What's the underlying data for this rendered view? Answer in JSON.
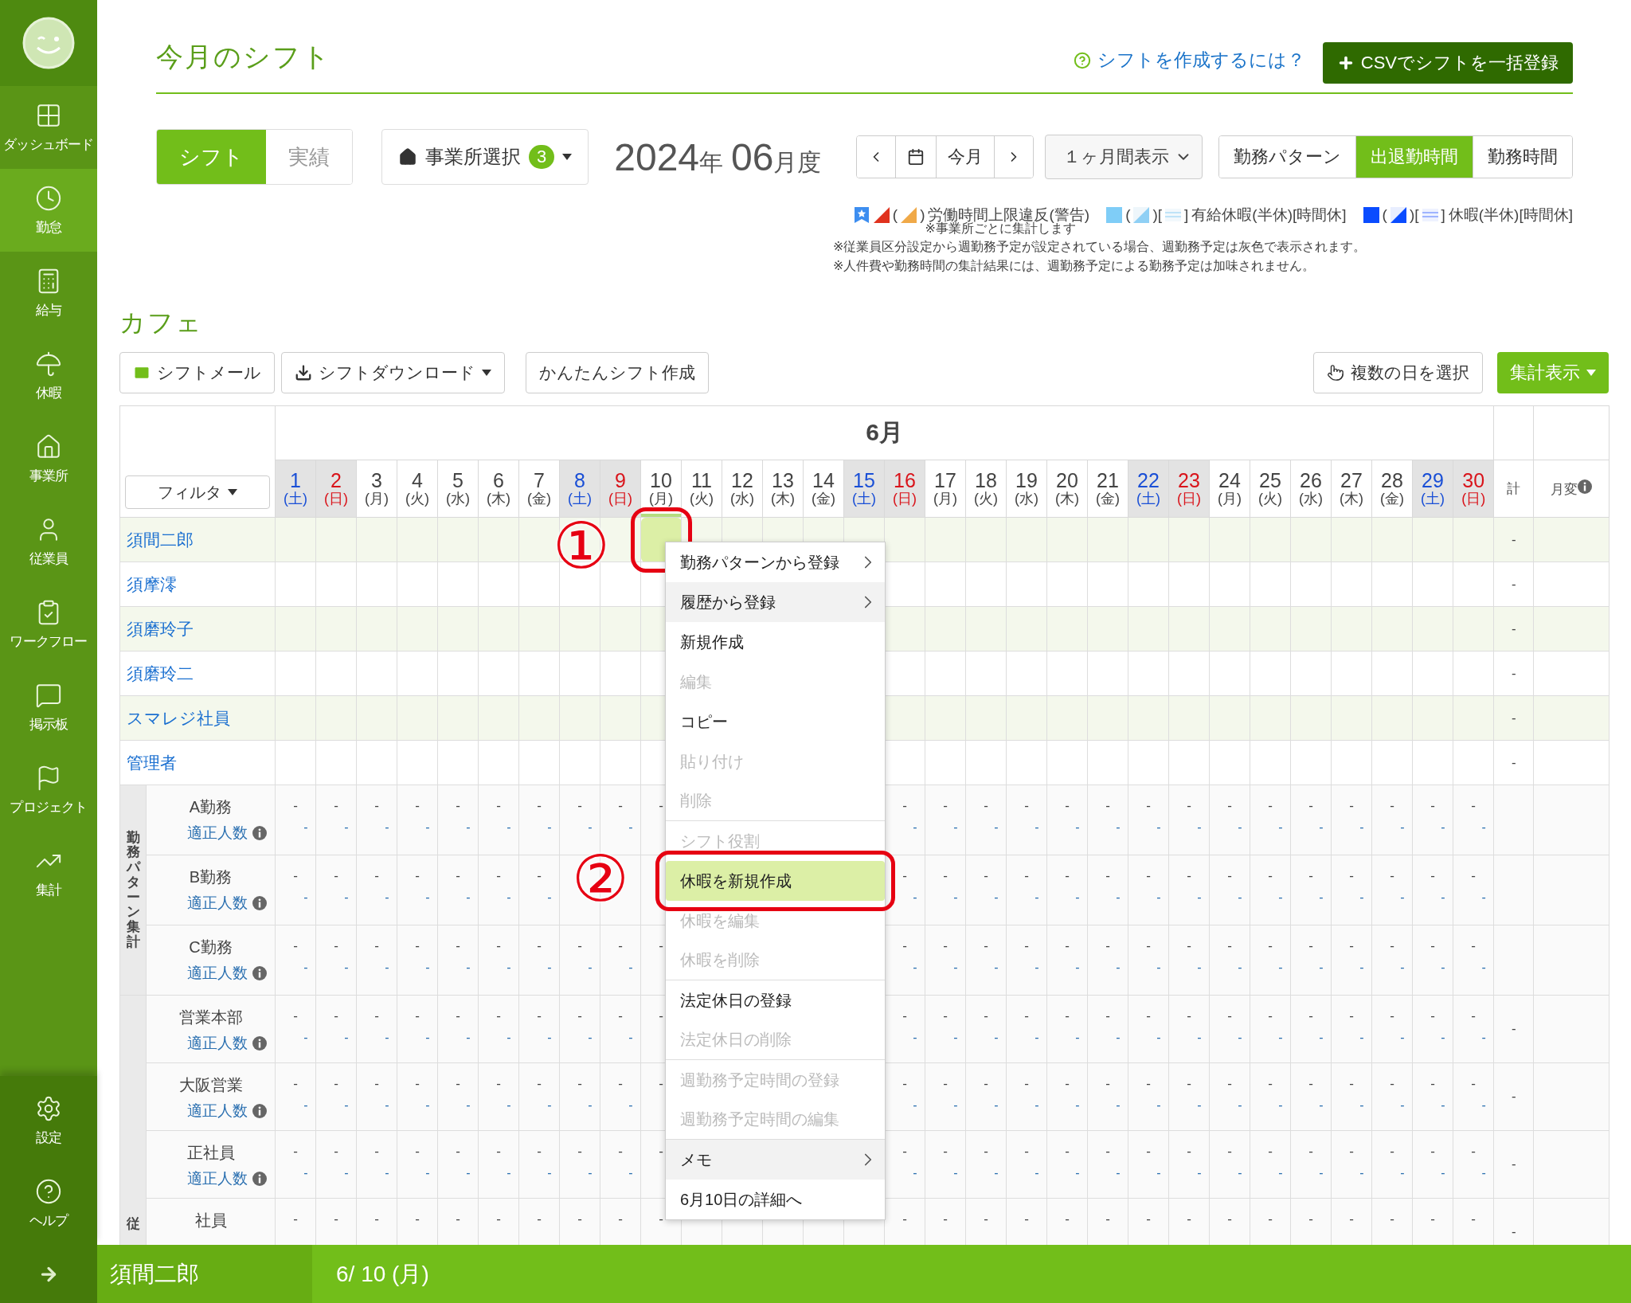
{
  "sidebar": {
    "items": [
      {
        "label": "ダッシュボード",
        "selected": false
      },
      {
        "label": "勤怠",
        "selected": true
      },
      {
        "label": "給与",
        "selected": false
      },
      {
        "label": "休暇",
        "selected": false
      },
      {
        "label": "事業所",
        "selected": false
      },
      {
        "label": "従業員",
        "selected": false
      },
      {
        "label": "ワークフロー",
        "selected": false
      },
      {
        "label": "掲示板",
        "selected": false
      },
      {
        "label": "プロジェクト",
        "selected": false
      },
      {
        "label": "集計",
        "selected": false
      }
    ],
    "bottom_items": [
      {
        "label": "設定"
      },
      {
        "label": "ヘルプ"
      }
    ]
  },
  "header": {
    "title": "今月のシフト",
    "help_link": "シフトを作成するには？",
    "csv_button": "CSVでシフトを一括登録"
  },
  "toolbar": {
    "mode_tabs": [
      {
        "label": "シフト",
        "selected": true
      },
      {
        "label": "実績",
        "selected": false
      }
    ],
    "office_button": {
      "label": "事業所選択",
      "count": "3"
    },
    "period": {
      "year": "2024",
      "year_unit": "年",
      "month": "06",
      "month_unit": "月度"
    },
    "nav": {
      "today": "今月"
    },
    "range_select": "１ヶ月間表示",
    "view_tabs": [
      {
        "label": "勤務パターン",
        "selected": false
      },
      {
        "label": "出退勤時間",
        "selected": true
      },
      {
        "label": "勤務時間",
        "selected": false
      }
    ]
  },
  "legend": [
    {
      "parts": [
        {
          "kind": "star"
        },
        {
          "kind": "red-triangle"
        },
        {
          "text": "("
        },
        {
          "kind": "orange-triangle"
        },
        {
          "text": ")"
        }
      ],
      "label": "労働時間上限違反(警告)",
      "note": "※事業所ごとに集計します"
    },
    {
      "parts": [
        {
          "kind": "light-square"
        },
        {
          "text": "("
        },
        {
          "kind": "light-triangle"
        },
        {
          "text": ")["
        },
        {
          "kind": "light-stripes"
        },
        {
          "text": "]"
        }
      ],
      "label": "有給休暇(半休)[時間休]"
    },
    {
      "parts": [
        {
          "kind": "blue-square"
        },
        {
          "text": "("
        },
        {
          "kind": "blue-triangle"
        },
        {
          "text": ")["
        },
        {
          "kind": "blue-stripes"
        },
        {
          "text": "]"
        }
      ],
      "label": "休暇(半休)[時間休]"
    }
  ],
  "notes": [
    "※従業員区分設定から週勤務予定が設定されている場合、週勤務予定は灰色で表示されます。",
    "※人件費や勤務時間の集計結果には、週勤務予定による勤務予定は加味されません。"
  ],
  "section": {
    "title": "カフェ",
    "left_buttons": [
      "シフトメール",
      "シフトダウンロード",
      "かんたんシフト作成"
    ],
    "multi_select_button": "複数の日を選択",
    "summary_button": "集計表示"
  },
  "table": {
    "filter": "フィルタ",
    "month": "6月",
    "total_header": "計",
    "change_header": "月変",
    "days": [
      {
        "day": "1",
        "weekday": "(土)",
        "kind": "sat",
        "selected": false
      },
      {
        "day": "2",
        "weekday": "(日)",
        "kind": "sun",
        "selected": false
      },
      {
        "day": "3",
        "weekday": "(月)",
        "kind": "weekday",
        "selected": false
      },
      {
        "day": "4",
        "weekday": "(火)",
        "kind": "weekday",
        "selected": false
      },
      {
        "day": "5",
        "weekday": "(水)",
        "kind": "weekday",
        "selected": false
      },
      {
        "day": "6",
        "weekday": "(木)",
        "kind": "weekday",
        "selected": false
      },
      {
        "day": "7",
        "weekday": "(金)",
        "kind": "weekday",
        "selected": false
      },
      {
        "day": "8",
        "weekday": "(土)",
        "kind": "sat",
        "selected": false
      },
      {
        "day": "9",
        "weekday": "(日)",
        "kind": "sun",
        "selected": false
      },
      {
        "day": "10",
        "weekday": "(月)",
        "kind": "weekday",
        "selected": true
      },
      {
        "day": "11",
        "weekday": "(火)",
        "kind": "weekday",
        "selected": false
      },
      {
        "day": "12",
        "weekday": "(水)",
        "kind": "weekday",
        "selected": false
      },
      {
        "day": "13",
        "weekday": "(木)",
        "kind": "weekday",
        "selected": false
      },
      {
        "day": "14",
        "weekday": "(金)",
        "kind": "weekday",
        "selected": false
      },
      {
        "day": "15",
        "weekday": "(土)",
        "kind": "sat",
        "selected": false
      },
      {
        "day": "16",
        "weekday": "(日)",
        "kind": "sun",
        "selected": false
      },
      {
        "day": "17",
        "weekday": "(月)",
        "kind": "weekday",
        "selected": false
      },
      {
        "day": "18",
        "weekday": "(火)",
        "kind": "weekday",
        "selected": false
      },
      {
        "day": "19",
        "weekday": "(水)",
        "kind": "weekday",
        "selected": false
      },
      {
        "day": "20",
        "weekday": "(木)",
        "kind": "weekday",
        "selected": false
      },
      {
        "day": "21",
        "weekday": "(金)",
        "kind": "weekday",
        "selected": false
      },
      {
        "day": "22",
        "weekday": "(土)",
        "kind": "sat",
        "selected": false
      },
      {
        "day": "23",
        "weekday": "(日)",
        "kind": "sun",
        "selected": false
      },
      {
        "day": "24",
        "weekday": "(月)",
        "kind": "weekday",
        "selected": false
      },
      {
        "day": "25",
        "weekday": "(火)",
        "kind": "weekday",
        "selected": false
      },
      {
        "day": "26",
        "weekday": "(水)",
        "kind": "weekday",
        "selected": false
      },
      {
        "day": "27",
        "weekday": "(木)",
        "kind": "weekday",
        "selected": false
      },
      {
        "day": "28",
        "weekday": "(金)",
        "kind": "weekday",
        "selected": false
      },
      {
        "day": "29",
        "weekday": "(土)",
        "kind": "sat",
        "selected": false
      },
      {
        "day": "30",
        "weekday": "(日)",
        "kind": "sun",
        "selected": false
      }
    ],
    "employees": [
      {
        "name": "須間二郎",
        "selected": true,
        "total": "-"
      },
      {
        "name": "須摩澪",
        "selected": false,
        "total": "-"
      },
      {
        "name": "須磨玲子",
        "selected": false,
        "total": "-"
      },
      {
        "name": "須磨玲二",
        "selected": false,
        "total": "-"
      },
      {
        "name": "スマレジ社員",
        "selected": false,
        "total": "-"
      },
      {
        "name": "管理者",
        "selected": false,
        "total": "-"
      }
    ],
    "summary_groups": [
      {
        "label": "勤務パターン集計",
        "rows": [
          {
            "name": "A勤務",
            "sub": "適正人数",
            "values": [
              "-",
              "-",
              "-",
              "-",
              "-",
              "-",
              "-",
              "-",
              "-",
              "-",
              "-",
              "-",
              "-",
              "-",
              "-",
              "-",
              "-",
              "-",
              "-",
              "-",
              "-",
              "-",
              "-",
              "-",
              "-"
            ],
            "counts": [
              "-",
              "-",
              "-",
              "-",
              "-",
              "-",
              "-",
              "-",
              "-",
              "-",
              "-",
              "-",
              "-",
              "-",
              "-",
              "-",
              "-",
              "-",
              "-",
              "-",
              "-",
              "-",
              "-",
              "-"
            ]
          },
          {
            "name": "B勤務",
            "sub": "適正人数",
            "values": [
              "-",
              "-",
              "-",
              "-",
              "-",
              "-",
              "-",
              "-",
              "-",
              "-",
              "-",
              "-",
              "-",
              "-",
              "-",
              "-",
              "-",
              "-",
              "-",
              "-",
              "-",
              "-"
            ],
            "counts": [
              "-",
              "-",
              "-",
              "-",
              "-",
              "-",
              "-",
              "-",
              "-",
              "-",
              "-",
              "-",
              "-",
              "-",
              "-",
              "-",
              "-",
              "-",
              "-",
              "-",
              "-",
              "-"
            ]
          },
          {
            "name": "C勤務",
            "sub": "適正人数",
            "values": [
              "-",
              "-",
              "-",
              "-",
              "-",
              "-",
              "-",
              "-",
              "-",
              "-",
              "-",
              "-",
              "-",
              "-",
              "-",
              "-",
              "-",
              "-",
              "-",
              "-",
              "-",
              "-",
              "-",
              "-",
              "-"
            ],
            "counts": [
              "-",
              "-",
              "-",
              "-",
              "-",
              "-",
              "-",
              "-",
              "-",
              "-",
              "-",
              "-",
              "-",
              "-",
              "-",
              "-",
              "-",
              "-",
              "-",
              "-",
              "-",
              "-",
              "-",
              "-"
            ]
          }
        ]
      },
      {
        "label": "従",
        "rows": [
          {
            "name": "営業本部",
            "sub": "適正人数",
            "total": "-",
            "values": [
              "-",
              "-",
              "-",
              "-",
              "-",
              "-",
              "-",
              "-",
              "-",
              "-",
              "-",
              "-",
              "-",
              "-",
              "-",
              "-",
              "-",
              "-",
              "-",
              "-",
              "-",
              "-",
              "-",
              "-",
              "-"
            ],
            "counts": [
              "-",
              "-",
              "-",
              "-",
              "-",
              "-",
              "-",
              "-",
              "-",
              "-",
              "-",
              "-",
              "-",
              "-",
              "-",
              "-",
              "-",
              "-",
              "-",
              "-",
              "-",
              "-",
              "-",
              "-"
            ]
          },
          {
            "name": "大阪営業",
            "sub": "適正人数",
            "total": "-",
            "values": [
              "-",
              "-",
              "-",
              "-",
              "-",
              "-",
              "-",
              "-",
              "-",
              "-",
              "-",
              "-",
              "-",
              "-",
              "-",
              "-",
              "-",
              "-",
              "-",
              "-",
              "-",
              "-",
              "-",
              "-",
              "-"
            ],
            "counts": [
              "-",
              "-",
              "-",
              "-",
              "-",
              "-",
              "-",
              "-",
              "-",
              "-",
              "-",
              "-",
              "-",
              "-",
              "-",
              "-",
              "-",
              "-",
              "-",
              "-",
              "-",
              "-",
              "-",
              "-"
            ]
          },
          {
            "name": "正社員",
            "sub": "適正人数",
            "total": "-",
            "values": [
              "-",
              "-",
              "-",
              "-",
              "-",
              "-",
              "-",
              "-",
              "-",
              "-",
              "-",
              "-",
              "-",
              "-",
              "-",
              "-",
              "-",
              "-",
              "-",
              "-",
              "-",
              "-",
              "-",
              "-",
              "-"
            ],
            "counts": [
              "-",
              "-",
              "-",
              "-",
              "-",
              "-",
              "-",
              "-",
              "-",
              "-",
              "-",
              "-",
              "-",
              "-",
              "-",
              "-",
              "-",
              "-",
              "-",
              "-",
              "-",
              "-",
              "-",
              "-"
            ]
          },
          {
            "name": "社員",
            "total": "-",
            "values": [
              "-",
              "-",
              "-",
              "-",
              "-",
              "-",
              "-",
              "-",
              "-",
              "-",
              "-",
              "-",
              "-",
              "-",
              "-",
              "-",
              "-",
              "-",
              "-",
              "-",
              "-",
              "-",
              "-",
              "-",
              "-"
            ]
          }
        ]
      }
    ]
  },
  "context_menu": {
    "items": [
      {
        "label": "勤務パターンから登録",
        "disabled": false,
        "has_submenu": true,
        "shaded": false,
        "selected": false,
        "separator_after": false
      },
      {
        "label": "履歴から登録",
        "disabled": false,
        "has_submenu": true,
        "shaded": true,
        "selected": false,
        "separator_after": false
      },
      {
        "label": "新規作成",
        "disabled": false,
        "has_submenu": false,
        "shaded": false,
        "selected": false,
        "separator_after": false
      },
      {
        "label": "編集",
        "disabled": true,
        "has_submenu": false,
        "shaded": false,
        "selected": false,
        "separator_after": false
      },
      {
        "label": "コピー",
        "disabled": false,
        "has_submenu": false,
        "shaded": false,
        "selected": false,
        "separator_after": false
      },
      {
        "label": "貼り付け",
        "disabled": true,
        "has_submenu": false,
        "shaded": false,
        "selected": false,
        "separator_after": false
      },
      {
        "label": "削除",
        "disabled": true,
        "has_submenu": false,
        "shaded": false,
        "selected": false,
        "separator_after": true
      },
      {
        "label": "シフト役割",
        "disabled": true,
        "has_submenu": false,
        "shaded": false,
        "selected": false,
        "separator_after": false
      },
      {
        "label": "休暇を新規作成",
        "disabled": false,
        "has_submenu": false,
        "shaded": false,
        "selected": true,
        "separator_after": false
      },
      {
        "label": "休暇を編集",
        "disabled": true,
        "has_submenu": false,
        "shaded": false,
        "selected": false,
        "separator_after": false
      },
      {
        "label": "休暇を削除",
        "disabled": true,
        "has_submenu": false,
        "shaded": false,
        "selected": false,
        "separator_after": true
      },
      {
        "label": "法定休日の登録",
        "disabled": false,
        "has_submenu": false,
        "shaded": false,
        "selected": false,
        "separator_after": false
      },
      {
        "label": "法定休日の削除",
        "disabled": true,
        "has_submenu": false,
        "shaded": false,
        "selected": false,
        "separator_after": true
      },
      {
        "label": "週勤務予定時間の登録",
        "disabled": true,
        "has_submenu": false,
        "shaded": false,
        "selected": false,
        "separator_after": false
      },
      {
        "label": "週勤務予定時間の編集",
        "disabled": true,
        "has_submenu": false,
        "shaded": false,
        "selected": false,
        "separator_after": true
      },
      {
        "label": "メモ",
        "disabled": false,
        "has_submenu": true,
        "shaded": true,
        "selected": false,
        "separator_after": false
      },
      {
        "label": "6月10日の詳細へ",
        "disabled": false,
        "has_submenu": false,
        "shaded": false,
        "selected": false,
        "separator_after": false
      }
    ]
  },
  "annotations": [
    {
      "label": "①"
    },
    {
      "label": "②"
    }
  ],
  "status_bar": {
    "employee": "須間二郎",
    "date": "6/ 10 (月)"
  }
}
